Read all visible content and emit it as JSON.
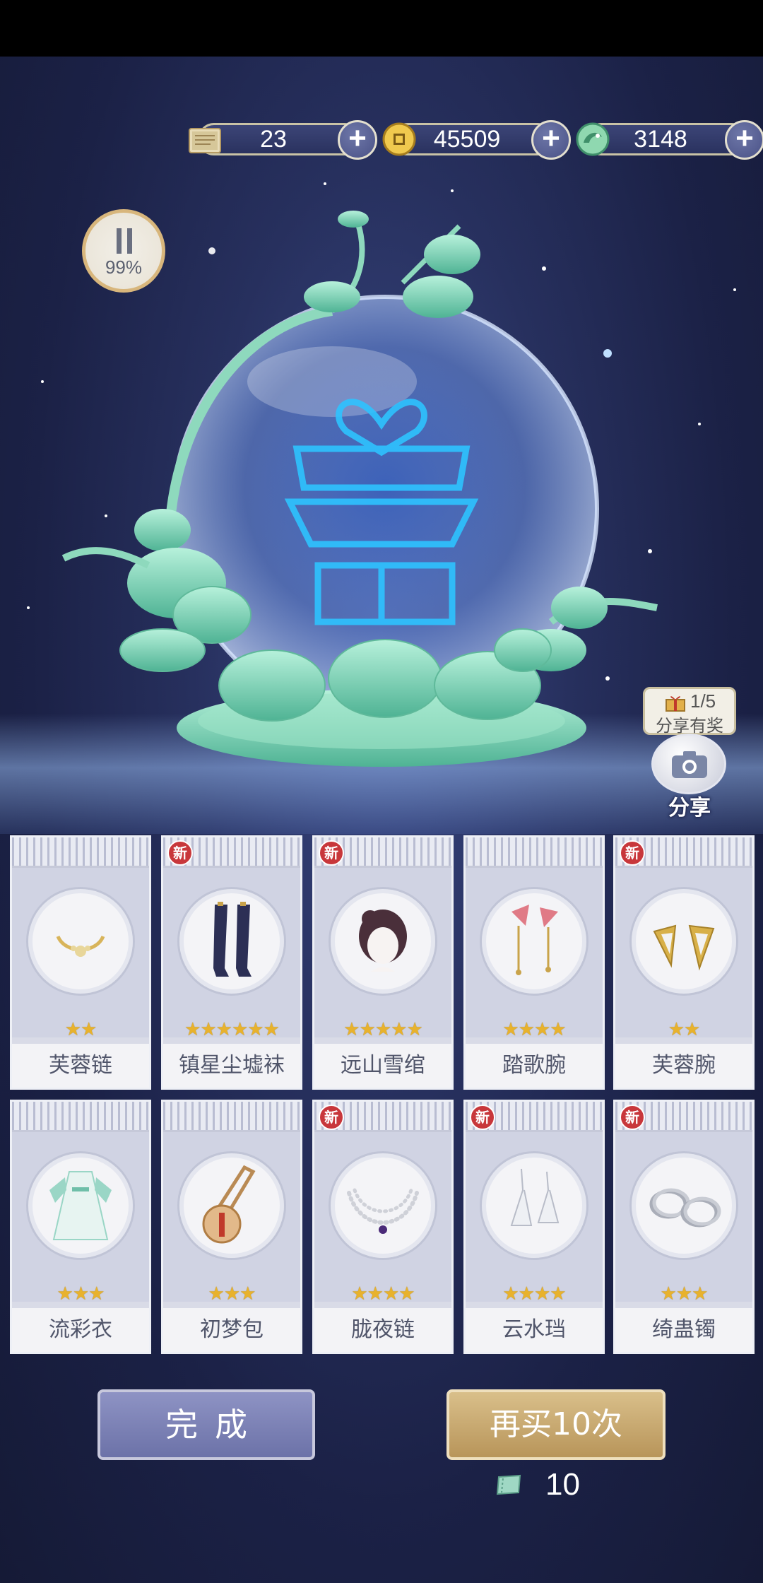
{
  "currencies": [
    {
      "icon": "scroll-icon",
      "value": "23"
    },
    {
      "icon": "gold-coin-icon",
      "value": "45509"
    },
    {
      "icon": "jade-dragon-icon",
      "value": "3148"
    }
  ],
  "pause": {
    "percent": "99%"
  },
  "share": {
    "progress": "1/5",
    "reward_label": "分享有奖",
    "label": "分享"
  },
  "items": [
    {
      "name": "芙蓉链",
      "stars": "★★",
      "is_new": false,
      "icon": "necklace-icon"
    },
    {
      "name": "镇星尘墟袜",
      "stars": "★★★★★★",
      "is_new": true,
      "badge": "新",
      "icon": "stockings-icon"
    },
    {
      "name": "远山雪绾",
      "stars": "★★★★★",
      "is_new": true,
      "badge": "新",
      "icon": "hairstyle-icon"
    },
    {
      "name": "踏歌腕",
      "stars": "★★★★",
      "is_new": false,
      "icon": "wrist-ornament-icon"
    },
    {
      "name": "芙蓉腕",
      "stars": "★★",
      "is_new": true,
      "badge": "新",
      "icon": "bracelet-icon"
    },
    {
      "name": "流彩衣",
      "stars": "★★★",
      "is_new": false,
      "icon": "dress-icon"
    },
    {
      "name": "初梦包",
      "stars": "★★★",
      "is_new": false,
      "icon": "bag-icon"
    },
    {
      "name": "胧夜链",
      "stars": "★★★★",
      "is_new": true,
      "badge": "新",
      "icon": "pearl-necklace-icon"
    },
    {
      "name": "云水珰",
      "stars": "★★★★",
      "is_new": true,
      "badge": "新",
      "icon": "earrings-icon"
    },
    {
      "name": "绮蛊镯",
      "stars": "★★★",
      "is_new": true,
      "badge": "新",
      "icon": "bangles-icon"
    }
  ],
  "buttons": {
    "done": "完成",
    "buy_again": "再买10次"
  },
  "cost": {
    "icon": "ticket-icon",
    "value": "10"
  },
  "colors": {
    "jade": "#7fd3b6",
    "gold": "#d3b47a",
    "new_badge": "#c8373b",
    "star": "#e8b22d"
  }
}
